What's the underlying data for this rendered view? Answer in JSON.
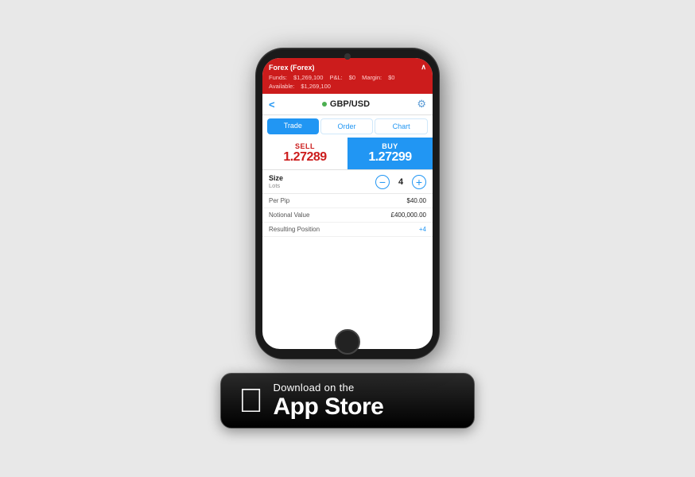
{
  "account": {
    "title": "Forex (Forex)",
    "funds_label": "Funds:",
    "funds_value": "$1,269,100",
    "pl_label": "P&L:",
    "pl_value": "$0",
    "margin_label": "Margin:",
    "margin_value": "$0",
    "available_label": "Available:",
    "available_value": "$1,269,100"
  },
  "instrument": {
    "name": "GBP/USD",
    "status": "active"
  },
  "tabs": [
    {
      "label": "Trade",
      "active": true
    },
    {
      "label": "Order",
      "active": false
    },
    {
      "label": "Chart",
      "active": false
    }
  ],
  "sell": {
    "label": "SELL",
    "price": "1.27289"
  },
  "buy": {
    "label": "BUY",
    "price": "1.27299"
  },
  "size": {
    "title": "Size",
    "subtitle": "Lots",
    "value": "4",
    "minus": "−",
    "plus": "+"
  },
  "info_rows": [
    {
      "label": "Per Pip",
      "value": "$40.00",
      "positive": false
    },
    {
      "label": "Notional Value",
      "value": "£400,000.00",
      "positive": false
    },
    {
      "label": "Resulting Position",
      "value": "+4",
      "positive": true
    }
  ],
  "appstore": {
    "top_line": "Download on the",
    "bottom_line": "App Store"
  }
}
